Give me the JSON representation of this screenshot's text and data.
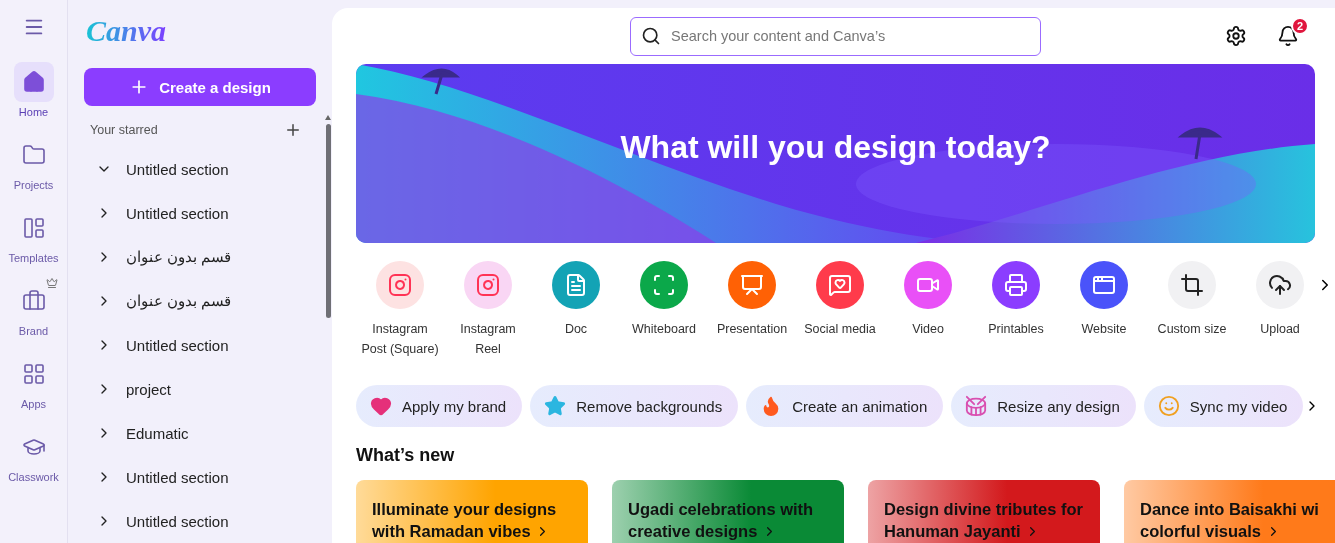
{
  "rail": {
    "items": [
      {
        "label": "Home",
        "selected": true
      },
      {
        "label": "Projects",
        "selected": false
      },
      {
        "label": "Templates",
        "selected": false
      },
      {
        "label": "Brand",
        "selected": false
      },
      {
        "label": "Apps",
        "selected": false
      },
      {
        "label": "Classwork",
        "selected": false
      }
    ]
  },
  "sidebar": {
    "logo": "Canva",
    "create_button": "Create a design",
    "section_title": "Your starred",
    "items": [
      {
        "label": "Untitled section",
        "expanded": true
      },
      {
        "label": "Untitled section",
        "expanded": false
      },
      {
        "label": "قسم بدون عنوان",
        "expanded": false
      },
      {
        "label": "قسم بدون عنوان",
        "expanded": false
      },
      {
        "label": "Untitled section",
        "expanded": false
      },
      {
        "label": "project",
        "expanded": false
      },
      {
        "label": "Edumatic",
        "expanded": false
      },
      {
        "label": "Untitled section",
        "expanded": false
      },
      {
        "label": "Untitled section",
        "expanded": false
      }
    ]
  },
  "search": {
    "placeholder": "Search your content and Canva’s"
  },
  "notifications": {
    "count": "2"
  },
  "banner": {
    "title": "What will you design today?"
  },
  "design_types": [
    {
      "label": "Instagram Post (Square)",
      "color": "#fde2e2"
    },
    {
      "label": "Instagram Reel",
      "color": "#f9d6f4"
    },
    {
      "label": "Doc",
      "color": "#13a3b5"
    },
    {
      "label": "Whiteboard",
      "color": "#0ba84a"
    },
    {
      "label": "Presentation",
      "color": "#ff6105"
    },
    {
      "label": "Social media",
      "color": "#ff3b4b"
    },
    {
      "label": "Video",
      "color": "#e950f7"
    },
    {
      "label": "Printables",
      "color": "#8b3dff"
    },
    {
      "label": "Website",
      "color": "#4a53fa"
    },
    {
      "label": "Custom size",
      "color": "#f1f1f3"
    },
    {
      "label": "Upload",
      "color": "#f1f1f3"
    }
  ],
  "quick_actions": [
    "Apply my brand",
    "Remove backgrounds",
    "Create an animation",
    "Resize any design",
    "Sync my video"
  ],
  "whats_new": {
    "title": "What’s new",
    "cards": [
      {
        "text": "Illuminate your designs with Ramadan vibes",
        "color": "#ffa400"
      },
      {
        "text": "Ugadi celebrations with creative designs",
        "color": "#0a8a36"
      },
      {
        "text": "Design divine tributes for Hanuman Jayanti",
        "color": "#d3191c"
      },
      {
        "text": "Dance into Baisakhi wi colorful visuals",
        "color": "#ff7a1a"
      }
    ]
  }
}
